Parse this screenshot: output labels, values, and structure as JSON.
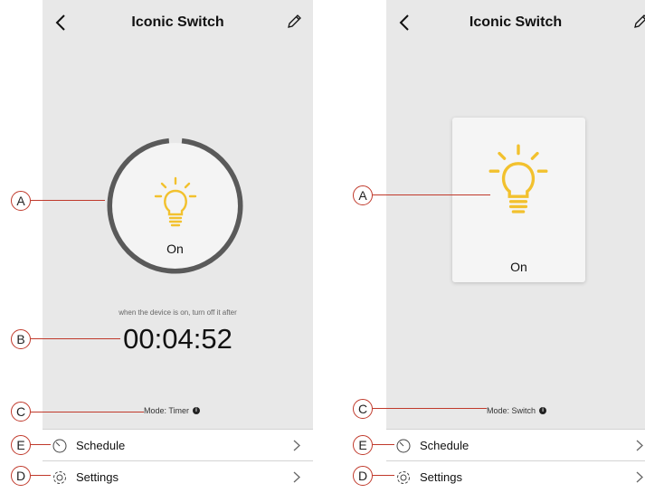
{
  "colors": {
    "accent_bulb": "#f2c12e",
    "callout": "#c0392b",
    "ring": "#5a5a5a"
  },
  "icons": {
    "back": "chevron-left-icon",
    "edit": "pencil-icon",
    "bulb": "lightbulb-icon",
    "schedule": "clock-icon",
    "settings": "gear-icon",
    "info": "info-icon"
  },
  "left": {
    "title": "Iconic Switch",
    "state": "On",
    "timer_hint": "when the device is on, turn off it after",
    "timer_value": "00:04:52",
    "mode": "Mode: Timer",
    "schedule_label": "Schedule",
    "settings_label": "Settings"
  },
  "right": {
    "title": "Iconic Switch",
    "state": "On",
    "mode": "Mode: Switch",
    "schedule_label": "Schedule",
    "settings_label": "Settings"
  },
  "callouts": {
    "a": "A",
    "b": "B",
    "c": "C",
    "d": "D",
    "e": "E"
  }
}
